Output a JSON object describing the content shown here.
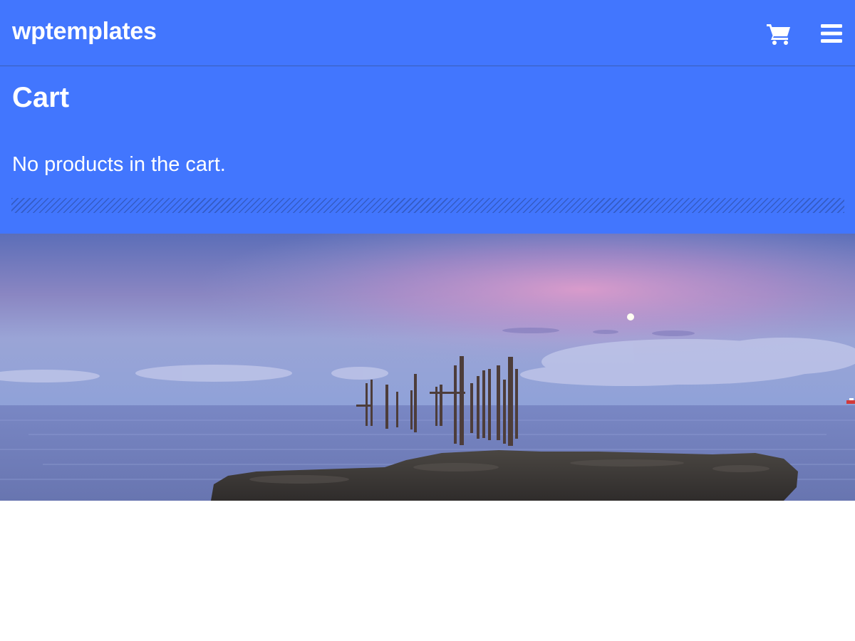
{
  "header": {
    "site_title": "wptemplates",
    "cart_icon": "shopping-cart-icon",
    "menu_icon": "hamburger-menu-icon"
  },
  "main": {
    "page_title": "Cart",
    "empty_message": "No products in the cart."
  },
  "colors": {
    "brand_blue": "#4276fe",
    "text": "#ffffff"
  }
}
